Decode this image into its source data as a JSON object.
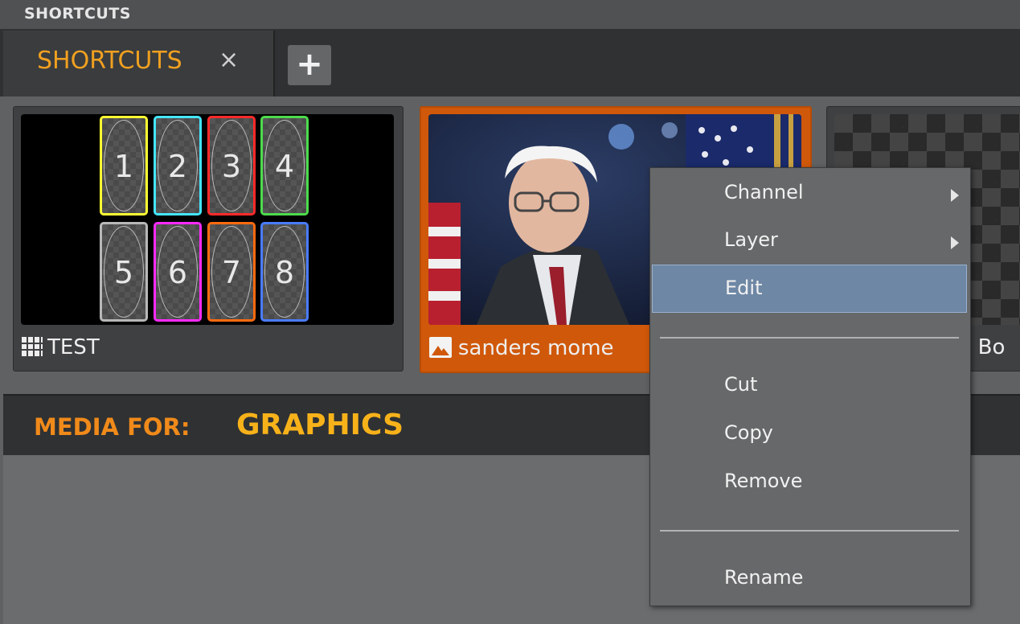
{
  "top_bar": {
    "title": "SHORTCUTS"
  },
  "tabs": [
    {
      "label": "SHORTCUTS",
      "close_icon": "×"
    }
  ],
  "add_button": {
    "label": "+"
  },
  "cards": [
    {
      "caption": "TEST",
      "icon": "grid-icon",
      "cells": [
        "1",
        "2",
        "3",
        "4",
        "5",
        "6",
        "7",
        "8"
      ],
      "cell_colors": [
        "#ffff33",
        "#44e6ff",
        "#ff2a2a",
        "#4ddb4d",
        "#b8b8b8",
        "#ff2aff",
        "#ff6a10",
        "#4a7cff"
      ]
    },
    {
      "caption": "sanders mome",
      "icon": "image-icon",
      "selected": true,
      "accent": "#d0580a"
    },
    {
      "caption": "y Bo",
      "icon": "image-icon"
    }
  ],
  "media_header": {
    "prefix": "MEDIA FOR:",
    "target": "GRAPHICS"
  },
  "context_menu": {
    "items": [
      {
        "label": "Channel",
        "submenu": true
      },
      {
        "label": "Layer",
        "submenu": true
      },
      {
        "label": "Edit",
        "highlighted": true
      },
      {
        "label": "Cut"
      },
      {
        "label": "Copy"
      },
      {
        "label": "Remove"
      },
      {
        "label": "Rename"
      }
    ]
  }
}
